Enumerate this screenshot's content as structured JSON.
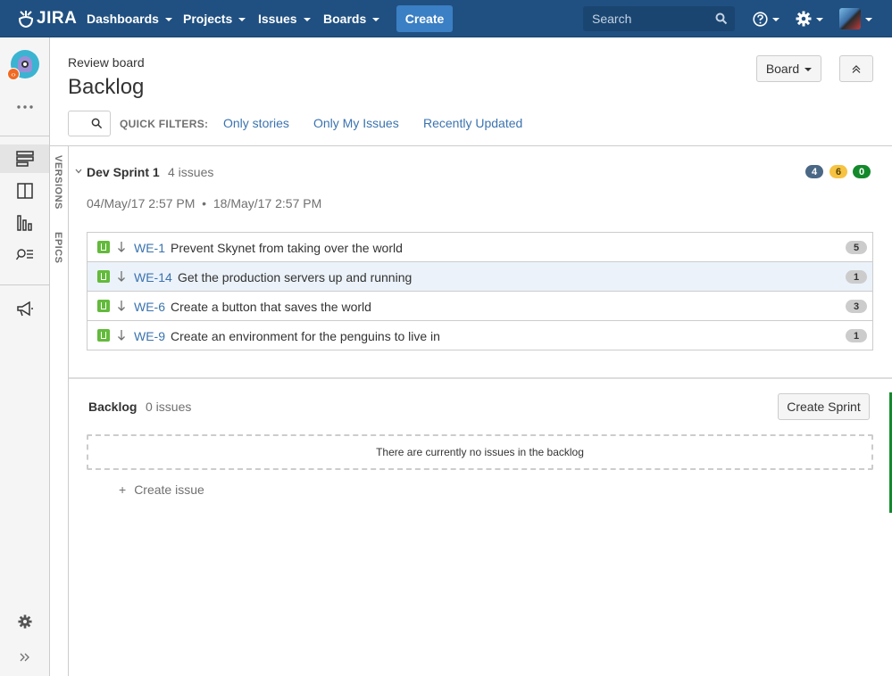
{
  "nav": {
    "logo": "JIRA",
    "items": [
      "Dashboards",
      "Projects",
      "Issues",
      "Boards"
    ],
    "create": "Create",
    "search_placeholder": "Search"
  },
  "header": {
    "breadcrumb": "Review board",
    "title": "Backlog",
    "board_button": "Board"
  },
  "quick_filters": {
    "label": "QUICK FILTERS:",
    "filters": [
      "Only stories",
      "Only My Issues",
      "Recently Updated"
    ]
  },
  "side_tabs": [
    "VERSIONS",
    "EPICS"
  ],
  "sprint": {
    "name": "Dev Sprint 1",
    "count": "4 issues",
    "dates": "04/May/17 2:57 PM  •  18/May/17 2:57 PM",
    "status_counts": [
      {
        "value": "4",
        "color": "#4a6785"
      },
      {
        "value": "6",
        "color": "#f6c342"
      },
      {
        "value": "0",
        "color": "#14892c"
      }
    ],
    "issues": [
      {
        "key": "WE-1",
        "summary": "Prevent Skynet from taking over the world",
        "estimate": "5"
      },
      {
        "key": "WE-14",
        "summary": "Get the production servers up and running",
        "estimate": "1"
      },
      {
        "key": "WE-6",
        "summary": "Create a button that saves the world",
        "estimate": "3"
      },
      {
        "key": "WE-9",
        "summary": "Create an environment for the penguins to live in",
        "estimate": "1"
      }
    ]
  },
  "backlog": {
    "title": "Backlog",
    "count": "0 issues",
    "create_sprint": "Create Sprint",
    "empty_message": "There are currently no issues in the backlog",
    "create_issue": "Create issue"
  }
}
